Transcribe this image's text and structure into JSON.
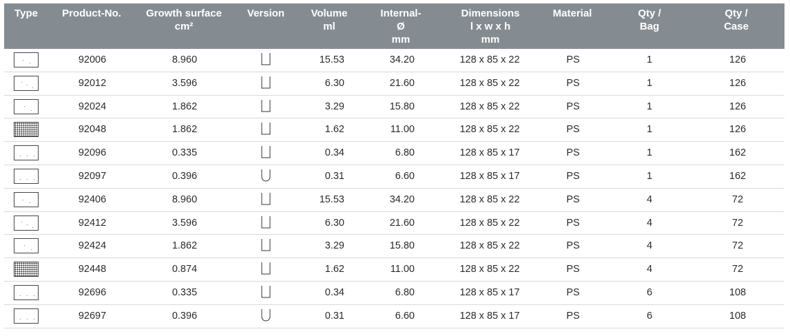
{
  "headers": {
    "type": "Type",
    "product_no": "Product-No.",
    "growth_line1": "Growth surface",
    "growth_line2": "cm²",
    "version": "Version",
    "volume_line1": "Volume",
    "volume_line2": "ml",
    "internal_line1": "Internal-",
    "internal_line2": "Ø",
    "internal_line3": "mm",
    "dimensions_line1": "Dimensions",
    "dimensions_line2": "l x w x h",
    "dimensions_line3": "mm",
    "material": "Material",
    "qty_bag_line1": "Qty /",
    "qty_bag_line2": "Bag",
    "qty_case_line1": "Qty /",
    "qty_case_line2": "Case"
  },
  "rows": [
    {
      "thumb": "plate-6-well-icon",
      "product_no": "92006",
      "growth": "8.960",
      "well_shape": "flat",
      "volume": "15.53",
      "diameter": "34.20",
      "dimensions": "128 x 85 x 22",
      "material": "PS",
      "qty_bag": "1",
      "qty_case": "126"
    },
    {
      "thumb": "plate-12-well-icon",
      "product_no": "92012",
      "growth": "3.596",
      "well_shape": "flat",
      "volume": "6.30",
      "diameter": "21.60",
      "dimensions": "128 x 85 x 22",
      "material": "PS",
      "qty_bag": "1",
      "qty_case": "126"
    },
    {
      "thumb": "plate-24-well-icon",
      "product_no": "92024",
      "growth": "1.862",
      "well_shape": "flat",
      "volume": "3.29",
      "diameter": "15.80",
      "dimensions": "128 x 85 x 22",
      "material": "PS",
      "qty_bag": "1",
      "qty_case": "126"
    },
    {
      "thumb": "plate-48-well-icon",
      "product_no": "92048",
      "growth": "1.862",
      "well_shape": "flat",
      "volume": "1.62",
      "diameter": "11.00",
      "dimensions": "128 x 85 x 22",
      "material": "PS",
      "qty_bag": "1",
      "qty_case": "126"
    },
    {
      "thumb": "plate-96-well-icon",
      "product_no": "92096",
      "growth": "0.335",
      "well_shape": "flat",
      "volume": "0.34",
      "diameter": "6.80",
      "dimensions": "128 x 85 x 17",
      "material": "PS",
      "qty_bag": "1",
      "qty_case": "162"
    },
    {
      "thumb": "plate-96-well-icon",
      "product_no": "92097",
      "growth": "0.396",
      "well_shape": "round",
      "volume": "0.31",
      "diameter": "6.60",
      "dimensions": "128 x 85 x 17",
      "material": "PS",
      "qty_bag": "1",
      "qty_case": "162"
    },
    {
      "thumb": "plate-6-well-icon",
      "product_no": "92406",
      "growth": "8.960",
      "well_shape": "flat",
      "volume": "15.53",
      "diameter": "34.20",
      "dimensions": "128 x 85 x 22",
      "material": "PS",
      "qty_bag": "4",
      "qty_case": "72"
    },
    {
      "thumb": "plate-12-well-icon",
      "product_no": "92412",
      "growth": "3.596",
      "well_shape": "flat",
      "volume": "6.30",
      "diameter": "21.60",
      "dimensions": "128 x 85 x 22",
      "material": "PS",
      "qty_bag": "4",
      "qty_case": "72"
    },
    {
      "thumb": "plate-24-well-icon",
      "product_no": "92424",
      "growth": "1.862",
      "well_shape": "flat",
      "volume": "3.29",
      "diameter": "15.80",
      "dimensions": "128 x 85 x 22",
      "material": "PS",
      "qty_bag": "4",
      "qty_case": "72"
    },
    {
      "thumb": "plate-48-well-icon",
      "product_no": "92448",
      "growth": "0.874",
      "well_shape": "flat",
      "volume": "1.62",
      "diameter": "11.00",
      "dimensions": "128 x 85 x 22",
      "material": "PS",
      "qty_bag": "4",
      "qty_case": "72"
    },
    {
      "thumb": "plate-96-well-icon",
      "product_no": "92696",
      "growth": "0.335",
      "well_shape": "flat",
      "volume": "0.34",
      "diameter": "6.80",
      "dimensions": "128 x 85 x 17",
      "material": "PS",
      "qty_bag": "6",
      "qty_case": "108"
    },
    {
      "thumb": "plate-96-well-icon",
      "product_no": "92697",
      "growth": "0.396",
      "well_shape": "round",
      "volume": "0.31",
      "diameter": "6.60",
      "dimensions": "128 x 85 x 17",
      "material": "PS",
      "qty_bag": "6",
      "qty_case": "108"
    }
  ],
  "colors": {
    "header_bg": "#858c91",
    "header_text": "#ffffff",
    "row_divider": "#d9d9d9"
  }
}
